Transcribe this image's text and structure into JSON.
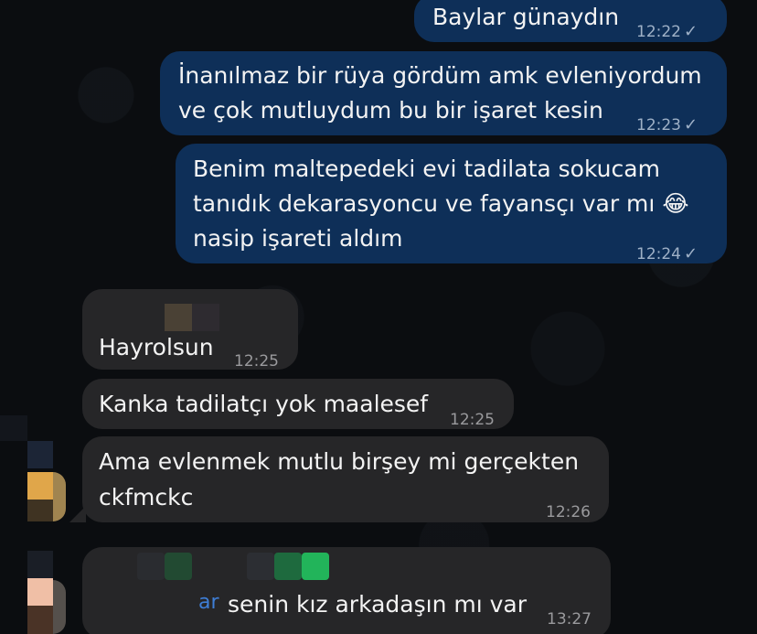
{
  "messages": [
    {
      "id": "m1",
      "direction": "outgoing",
      "lines": [
        "Baylar günaydın"
      ],
      "time": "12:22",
      "status": "sent"
    },
    {
      "id": "m2",
      "direction": "outgoing",
      "lines": [
        "İnanılmaz bir rüya gördüm amk evleniyordum",
        "ve çok mutluydum bu bir işaret kesin"
      ],
      "time": "12:23",
      "status": "sent"
    },
    {
      "id": "m3",
      "direction": "outgoing",
      "lines": [
        "Benim maltepedeki evi tadilata sokucam",
        "tanıdık dekarasyoncu ve fayansçı var mı",
        "nasip işareti aldım"
      ],
      "emoji": "😂",
      "time": "12:24",
      "status": "sent"
    },
    {
      "id": "m4",
      "direction": "incoming",
      "sender": "",
      "lines": [
        "Hayrolsun"
      ],
      "time": "12:25"
    },
    {
      "id": "m5",
      "direction": "incoming",
      "lines": [
        "Kanka tadilatçı yok maalesef"
      ],
      "time": "12:25"
    },
    {
      "id": "m6",
      "direction": "incoming",
      "lines": [
        "Ama evlenmek mutlu birşey mi gerçekten",
        "ckfmckc"
      ],
      "time": "12:26"
    },
    {
      "id": "m7",
      "direction": "incoming",
      "lines": [
        "senin kız arkadaşın mı var"
      ],
      "quote_fragment": "ar",
      "time": "13:27"
    }
  ],
  "icons": {
    "read_receipt": "checkmark-icon"
  },
  "colors": {
    "background": "#0b0d10",
    "outgoing_bubble": "#0e2f58",
    "incoming_bubble": "#262628",
    "text": "#f3f3f3"
  }
}
